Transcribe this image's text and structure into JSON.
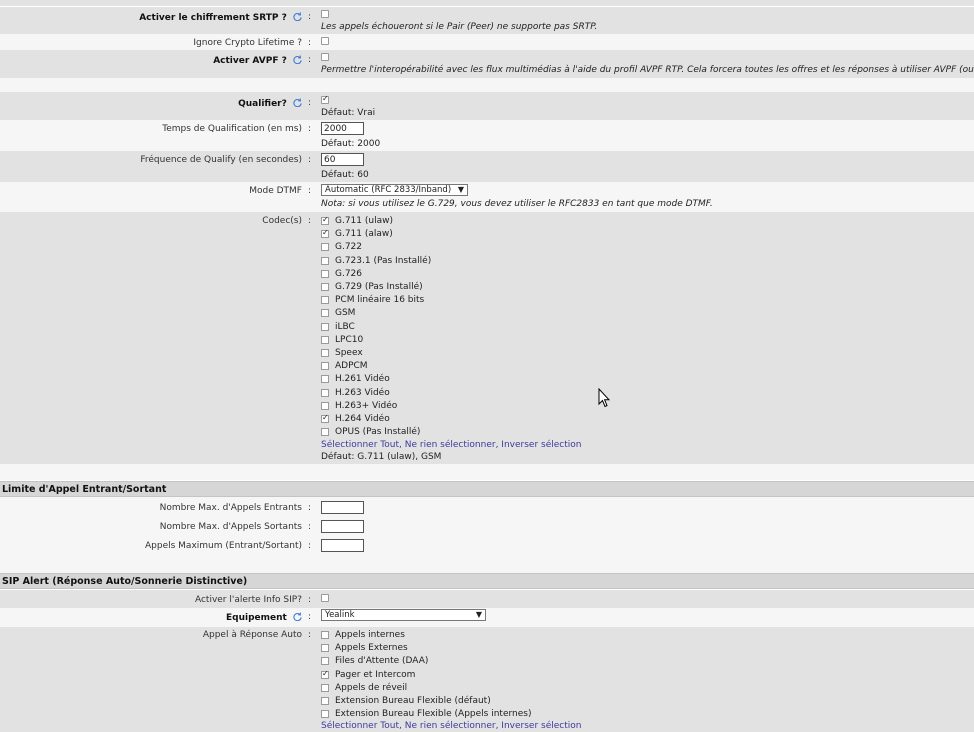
{
  "srtp": {
    "label": "Activer le chiffrement SRTP ?",
    "note": "Les appels échoueront si le Pair (Peer) ne supporte pas SRTP."
  },
  "ignore_crypto": {
    "label": "Ignore Crypto Lifetime ?"
  },
  "avpf": {
    "label": "Activer AVPF ?",
    "note": "Permettre l'interopérabilité avec les flux multimédias à l'aide du profil AVPF RTP. Cela forcera toutes les offres et les réponses à utiliser AVPF (ou SAVPF)."
  },
  "qualifier": {
    "label": "Qualifier?",
    "default": "Défaut: Vrai",
    "checked": true
  },
  "qualify_time": {
    "label": "Temps de Qualification (en ms)",
    "value": "2000",
    "default": "Défaut: 2000"
  },
  "qualify_freq": {
    "label": "Fréquence de Qualify (en secondes)",
    "value": "60",
    "default": "Défaut: 60"
  },
  "dtmf": {
    "label": "Mode DTMF",
    "selected": "Automatic (RFC 2833/Inband)",
    "note": "Nota: si vous utilisez le G.729, vous devez utiliser le RFC2833 en tant que mode DTMF."
  },
  "codecs": {
    "label": "Codec(s)",
    "items": [
      {
        "name": "G.711 (ulaw)",
        "checked": true
      },
      {
        "name": "G.711 (alaw)",
        "checked": true
      },
      {
        "name": "G.722",
        "checked": false
      },
      {
        "name": "G.723.1 (Pas Installé)",
        "checked": false
      },
      {
        "name": "G.726",
        "checked": false
      },
      {
        "name": "G.729 (Pas Installé)",
        "checked": false
      },
      {
        "name": "PCM linéaire 16 bits",
        "checked": false
      },
      {
        "name": "GSM",
        "checked": false
      },
      {
        "name": "iLBC",
        "checked": false
      },
      {
        "name": "LPC10",
        "checked": false
      },
      {
        "name": "Speex",
        "checked": false
      },
      {
        "name": "ADPCM",
        "checked": false
      },
      {
        "name": "H.261 Vidéo",
        "checked": false
      },
      {
        "name": "H.263 Vidéo",
        "checked": false
      },
      {
        "name": "H.263+ Vidéo",
        "checked": false
      },
      {
        "name": "H.264 Vidéo",
        "checked": true
      },
      {
        "name": "OPUS (Pas Installé)",
        "checked": false
      }
    ],
    "select_all": "Sélectionner Tout",
    "select_none": "Ne rien sélectionner",
    "invert": "Inverser sélection",
    "default": "Défaut: G.711 (ulaw), GSM"
  },
  "call_limit": {
    "title": "Limite d'Appel Entrant/Sortant",
    "max_in": "Nombre Max. d'Appels Entrants",
    "max_out": "Nombre Max. d'Appels Sortants",
    "max_total": "Appels Maximum (Entrant/Sortant)"
  },
  "sip_alert": {
    "title": "SIP Alert (Réponse Auto/Sonnerie Distinctive)",
    "info_label": "Activer l'alerte Info SIP?",
    "equipment_label": "Equipement",
    "equipment_value": "Yealink",
    "auto_answer_label": "Appel à Réponse Auto",
    "auto_items": [
      {
        "name": "Appels internes",
        "checked": false
      },
      {
        "name": "Appels Externes",
        "checked": false
      },
      {
        "name": "Files d'Attente (DAA)",
        "checked": false
      },
      {
        "name": "Pager et Intercom",
        "checked": true
      },
      {
        "name": "Appels de réveil",
        "checked": false
      },
      {
        "name": "Extension Bureau Flexible (défaut)",
        "checked": false
      },
      {
        "name": "Extension Bureau Flexible (Appels internes)",
        "checked": false
      }
    ],
    "select_all": "Sélectionner Tout",
    "select_none": "Ne rien sélectionner",
    "invert": "Inverser sélection"
  },
  "colors": {
    "label_bg": "#e2e2e2",
    "link": "#3b3b9c",
    "section_bg": "#d6d6d6",
    "info_icon": "#3a7bd5"
  }
}
